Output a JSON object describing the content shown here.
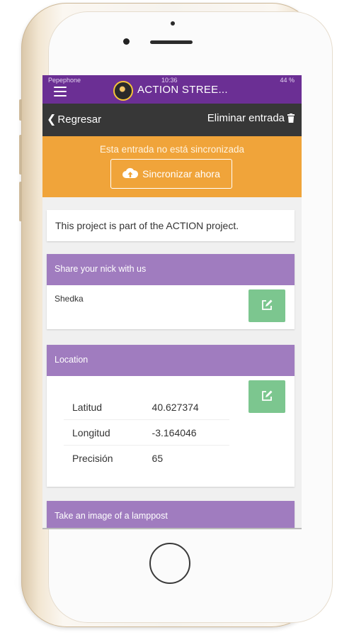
{
  "status_bar": {
    "carrier": "Pepephone",
    "time": "10:36",
    "battery": "44 %"
  },
  "header": {
    "app_title": "ACTION STREE..."
  },
  "nav": {
    "back_label": "Regresar",
    "delete_label": "Eliminar entrada"
  },
  "sync": {
    "message": "Esta entrada no está sincronizada",
    "button_label": "Sincronizar ahora"
  },
  "info": {
    "text": "This project is part of the ACTION project."
  },
  "nick_card": {
    "header": "Share your nick with us",
    "value": "Shedka"
  },
  "location_card": {
    "header": "Location",
    "rows": [
      {
        "label": "Latitud",
        "value": "40.627374"
      },
      {
        "label": "Longitud",
        "value": "-3.164046"
      },
      {
        "label": "Precisión",
        "value": "65"
      }
    ]
  },
  "image_card": {
    "header": "Take an image of a lamppost"
  },
  "colors": {
    "header_purple": "#6b2f94",
    "nav_dark": "#373737",
    "sync_orange": "#f0a43a",
    "card_header_purple": "#a07cbf",
    "edit_green": "#7cc68f"
  },
  "icons": [
    "menu-icon",
    "back-chevron-icon",
    "trash-icon",
    "cloud-upload-icon",
    "edit-icon"
  ]
}
